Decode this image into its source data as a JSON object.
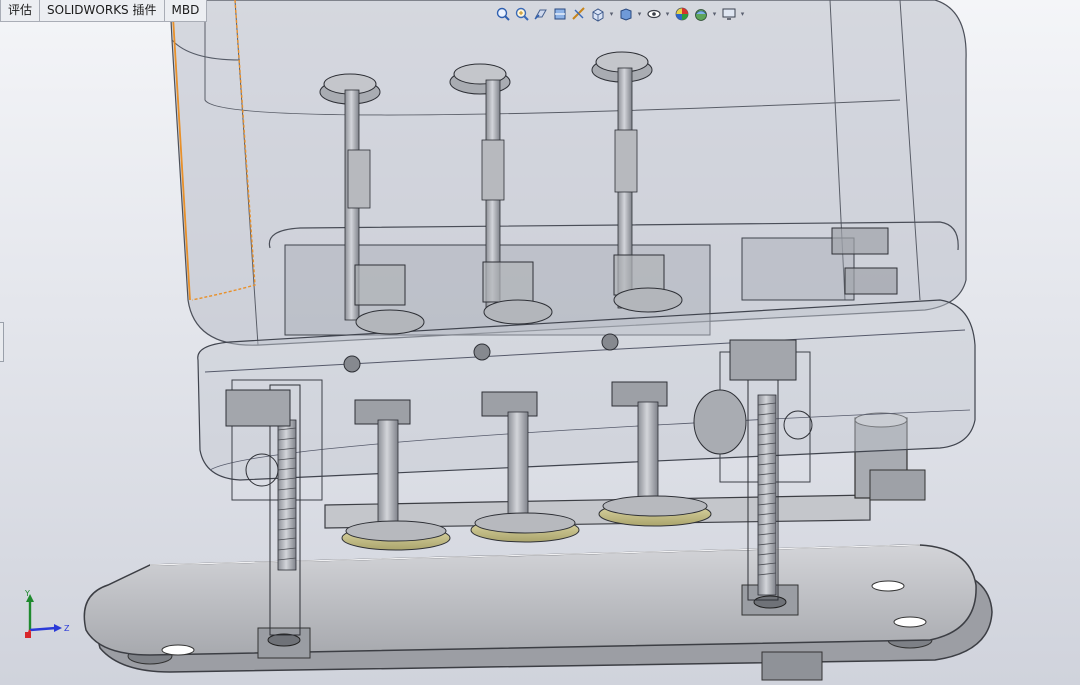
{
  "command_tabs": [
    {
      "label": "评估"
    },
    {
      "label": "SOLIDWORKS 插件"
    },
    {
      "label": "MBD"
    }
  ],
  "heads_up_toolbar": {
    "icons": [
      "zoom-to-fit-icon",
      "zoom-to-area-icon",
      "previous-view-icon",
      "section-view-icon",
      "dynamic-annotation-icon",
      "view-orientation-icon",
      "display-style-icon",
      "hide-show-items-icon",
      "edit-appearance-icon",
      "apply-scene-icon",
      "view-settings-icon"
    ]
  },
  "triad": {
    "x_label": "",
    "y_label": "Y",
    "z_label": "Z"
  },
  "colors": {
    "housing": "#b8bcc8",
    "metal": "#a6a8ad",
    "brass": "#c8c290",
    "selection_edge": "#e8902a",
    "triad_y": "#1f8a2e",
    "triad_z": "#2a3ad8",
    "triad_x": "#d8262a"
  }
}
